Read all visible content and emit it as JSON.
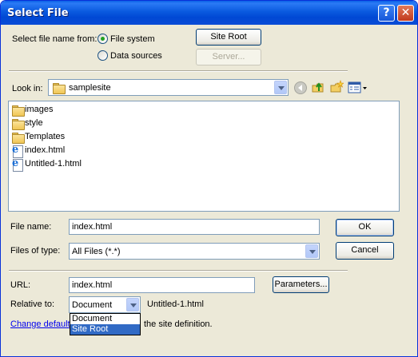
{
  "window": {
    "title": "Select File",
    "help_glyph": "?",
    "close_glyph": "✕"
  },
  "source": {
    "label": "Select file name from:",
    "options": [
      {
        "label": "File system",
        "selected": true
      },
      {
        "label": "Data sources",
        "selected": false
      }
    ],
    "site_root_button": "Site Root",
    "server_button": "Server..."
  },
  "lookin": {
    "label": "Look in:",
    "value": "samplesite",
    "icons": [
      "back-icon",
      "up-folder-icon",
      "new-folder-icon",
      "view-menu-icon"
    ]
  },
  "files": [
    {
      "name": "images",
      "type": "folder"
    },
    {
      "name": "style",
      "type": "folder"
    },
    {
      "name": "Templates",
      "type": "folder"
    },
    {
      "name": "index.html",
      "type": "html"
    },
    {
      "name": "Untitled-1.html",
      "type": "html"
    }
  ],
  "filename": {
    "label": "File name:",
    "value": "index.html",
    "ok_button": "OK"
  },
  "filetype": {
    "label": "Files of type:",
    "value": "All Files (*.*)",
    "cancel_button": "Cancel"
  },
  "url": {
    "label": "URL:",
    "value": "index.html",
    "parameters_button": "Parameters..."
  },
  "relative": {
    "label": "Relative to:",
    "value": "Document",
    "doc_name": "Untitled-1.html",
    "options": [
      {
        "label": "Document",
        "selected": false
      },
      {
        "label": "Site Root",
        "selected": true
      }
    ]
  },
  "footer": {
    "link_text": "Change default",
    "rest_text": "the site definition."
  },
  "colors": {
    "titlebar": "#0a5adf",
    "dialog_bg": "#ece9d8",
    "selection": "#316ac5",
    "link": "#0000ee"
  }
}
